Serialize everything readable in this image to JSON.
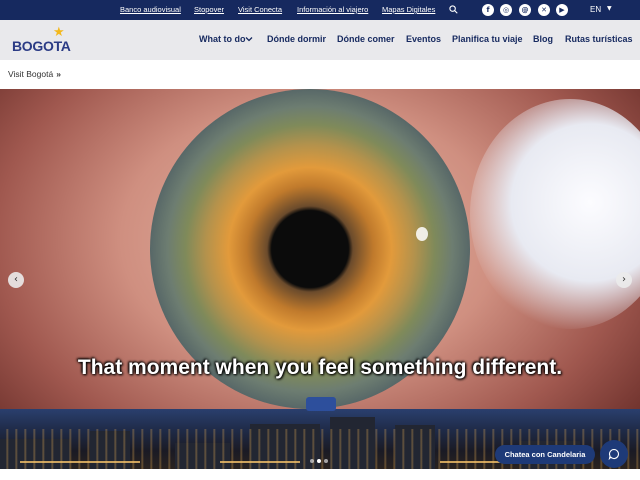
{
  "topbar": {
    "links": [
      "Banco audiovisual",
      "Stopover",
      "Visit Conecta",
      "Información al viajero",
      "Mapas Digitales"
    ],
    "language": "EN",
    "social_icons": [
      "facebook-icon",
      "instagram-icon",
      "threads-icon",
      "x-icon",
      "youtube-icon"
    ]
  },
  "logo": {
    "text": "BOGOTA"
  },
  "nav": {
    "items": [
      "What to do",
      "Dónde dormir",
      "Dónde comer",
      "Eventos",
      "Planifica tu viaje",
      "Blog",
      "Rutas turísticas"
    ]
  },
  "breadcrumb": {
    "home": "Visit Bogotá",
    "separator": "»"
  },
  "hero": {
    "caption": "That moment when you feel something different.",
    "prev_glyph": "‹",
    "next_glyph": "›"
  },
  "chat": {
    "label": "Chatea con Candelaria"
  },
  "colors": {
    "topbar": "#16295f",
    "navbar": "#e9e9ec",
    "brand": "#2b3b85",
    "accent": "#f3b81c",
    "chat": "#1e3a78"
  }
}
